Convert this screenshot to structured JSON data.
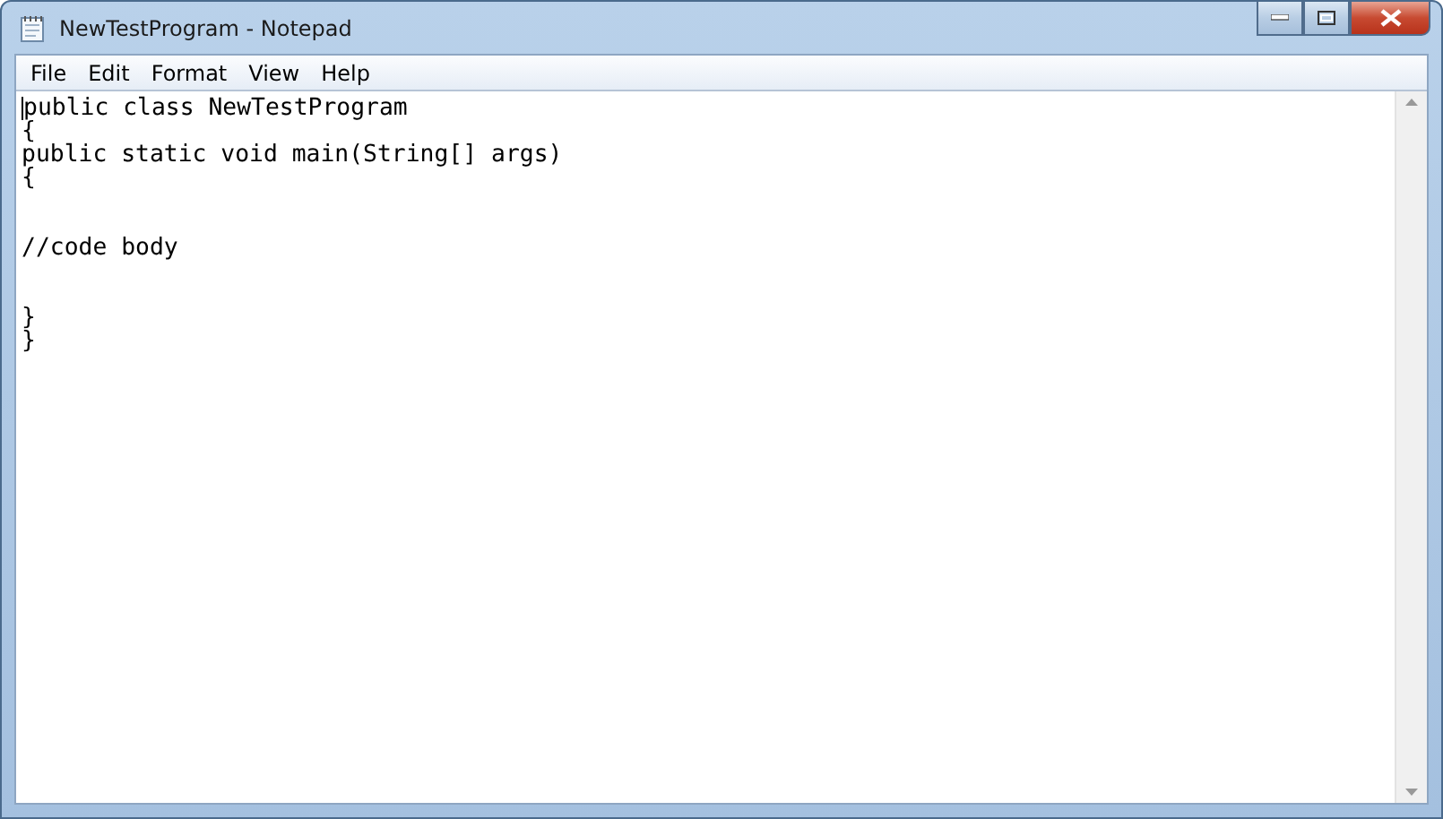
{
  "window": {
    "title": "NewTestProgram - Notepad"
  },
  "menu": [
    {
      "label": "File"
    },
    {
      "label": "Edit"
    },
    {
      "label": "Format"
    },
    {
      "label": "View"
    },
    {
      "label": "Help"
    }
  ],
  "editor": {
    "text": "public class NewTestProgram\n{\npublic static void main(String[] args)\n{\n\n\n//code body\n\n\n}\n}"
  }
}
